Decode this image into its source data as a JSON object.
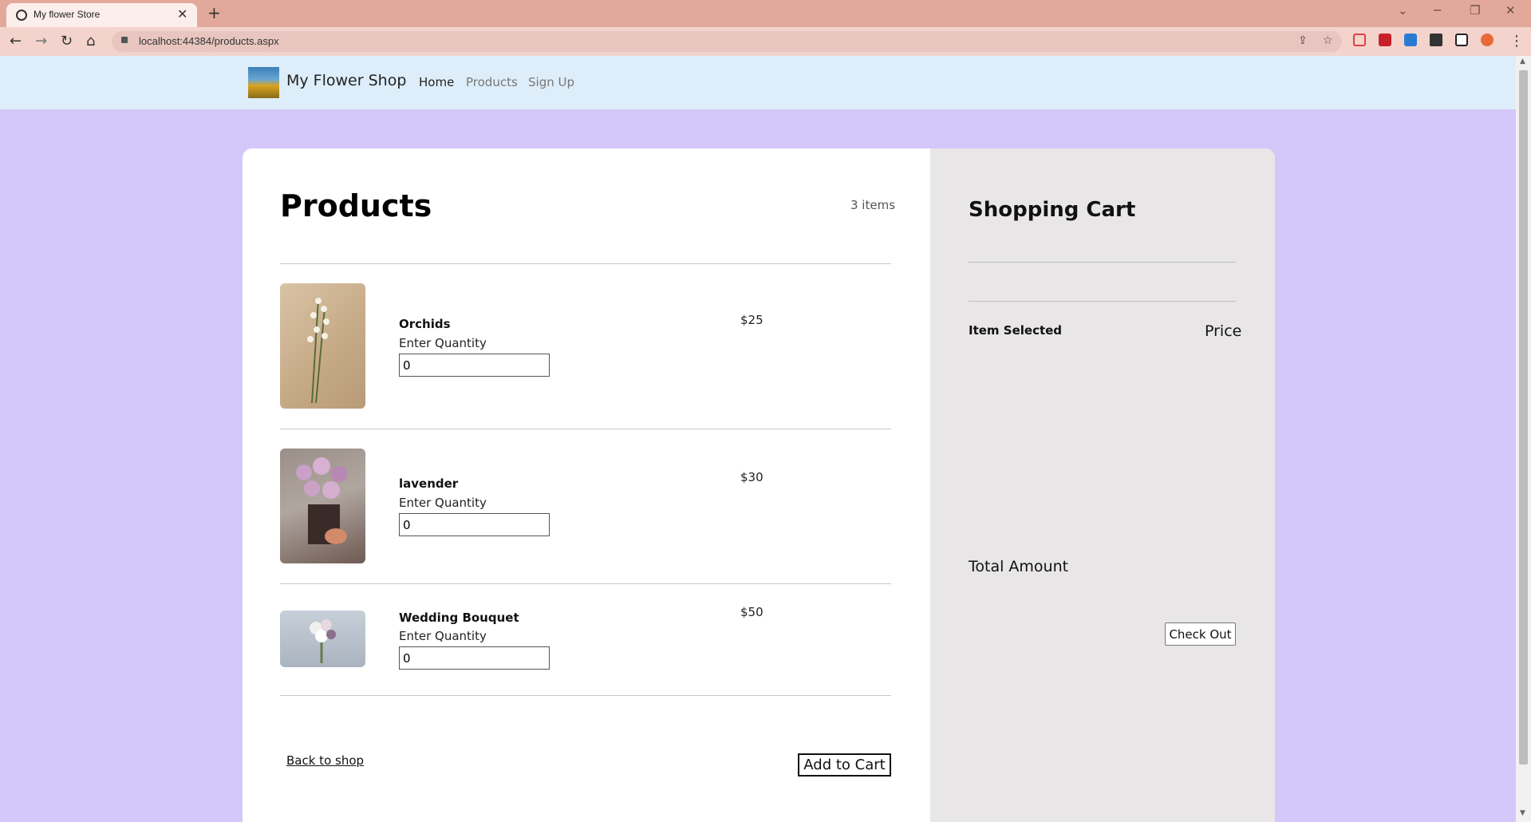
{
  "browser": {
    "tab_title": "My flower Store",
    "tab_close": "✕",
    "new_tab": "+",
    "url": "localhost:44384/products.aspx",
    "back": "←",
    "forward": "→",
    "reload": "↻",
    "home": "⌂",
    "window_controls": {
      "dropdown": "⌄",
      "minimize": "─",
      "restore": "❐",
      "close": "✕"
    },
    "menu": "⋮"
  },
  "navbar": {
    "brand": "My Flower Shop",
    "links": [
      {
        "label": "Home",
        "color": "#222222"
      },
      {
        "label": "Products",
        "color": "#777777"
      },
      {
        "label": "Sign Up",
        "color": "#777777"
      }
    ]
  },
  "products": {
    "title": "Products",
    "count": "3 items",
    "quantity_label": "Enter Quantity",
    "items": [
      {
        "name": "Orchids",
        "price": "$25",
        "quantity": "0"
      },
      {
        "name": "lavender",
        "price": "$30",
        "quantity": "0"
      },
      {
        "name": "Wedding Bouquet",
        "price": "$50",
        "quantity": "0"
      }
    ],
    "back_link": "Back to shop",
    "add_to_cart": "Add to Cart"
  },
  "cart": {
    "title": "Shopping Cart",
    "col_item": "Item Selected",
    "col_price": "Price",
    "total_label": "Total Amount",
    "checkout": "Check Out"
  },
  "colors": {
    "page_bg": "#d4c8fa",
    "navbar_bg": "#ddeefa",
    "cart_bg": "#e8e6e6",
    "tab_bar": "#e2a99b"
  }
}
